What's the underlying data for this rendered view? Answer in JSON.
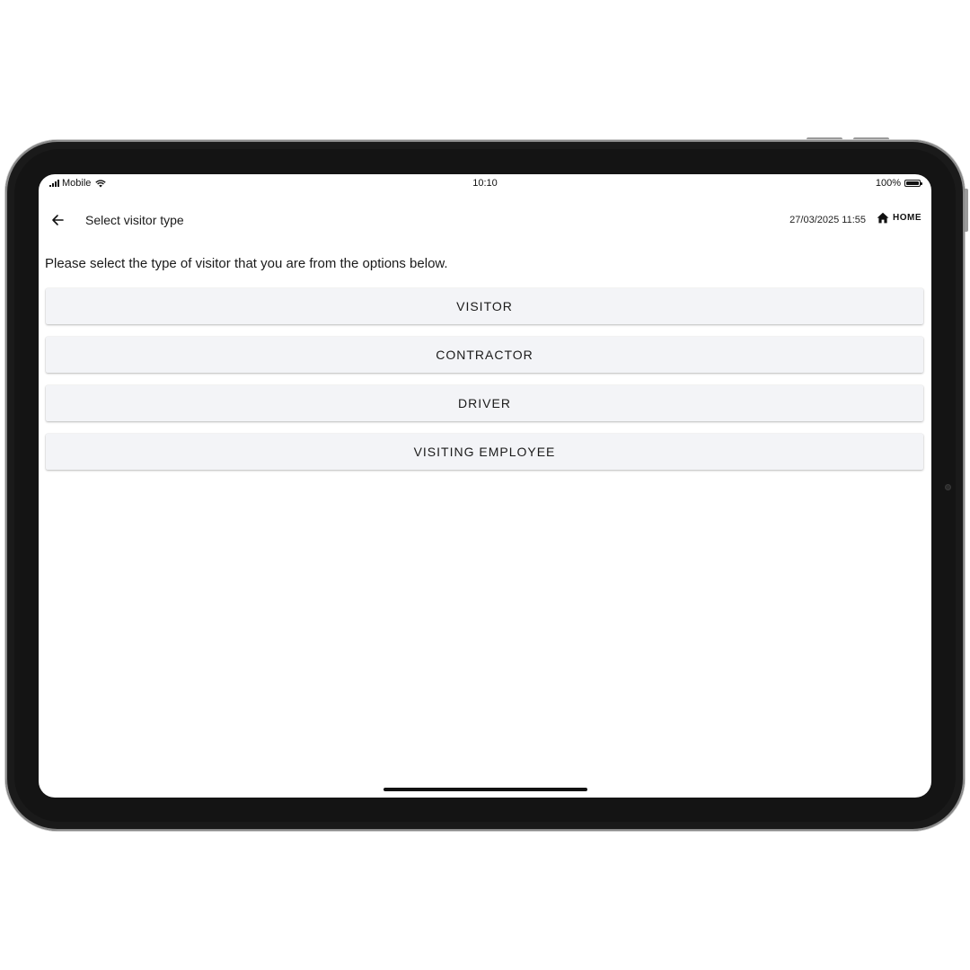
{
  "status_bar": {
    "carrier": "Mobile",
    "time": "10:10",
    "battery_percent": "100%",
    "icons": [
      "signal-icon",
      "wifi-icon",
      "battery-icon"
    ]
  },
  "header": {
    "title": "Select visitor type",
    "datetime": "27/03/2025 11:55",
    "home_label": "HOME",
    "icons": [
      "back-arrow-icon",
      "home-icon"
    ]
  },
  "content": {
    "instructions": "Please select the type of visitor that you are from the options below.",
    "options": [
      {
        "label": "VISITOR"
      },
      {
        "label": "CONTRACTOR"
      },
      {
        "label": "DRIVER"
      },
      {
        "label": "VISITING EMPLOYEE"
      }
    ]
  },
  "colors": {
    "device_frame": "#1a1a1a",
    "screen_background": "#ffffff",
    "option_background": "#f3f4f7",
    "text": "#1a1a1a"
  }
}
